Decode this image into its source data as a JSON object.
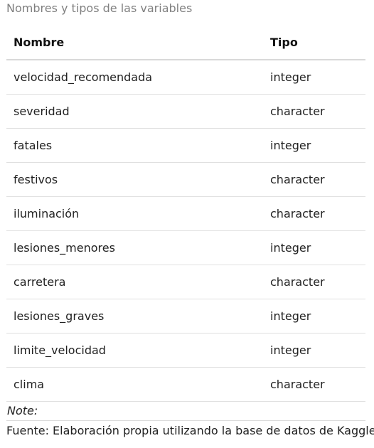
{
  "caption": "Nombres y tipos de las variables",
  "table": {
    "headers": [
      "Nombre",
      "Tipo"
    ],
    "rows": [
      {
        "nombre": "velocidad_recomendada",
        "tipo": "integer"
      },
      {
        "nombre": "severidad",
        "tipo": "character"
      },
      {
        "nombre": "fatales",
        "tipo": "integer"
      },
      {
        "nombre": "festivos",
        "tipo": "character"
      },
      {
        "nombre": "iluminación",
        "tipo": "character"
      },
      {
        "nombre": "lesiones_menores",
        "tipo": "integer"
      },
      {
        "nombre": "carretera",
        "tipo": "character"
      },
      {
        "nombre": "lesiones_graves",
        "tipo": "integer"
      },
      {
        "nombre": "limite_velocidad",
        "tipo": "integer"
      },
      {
        "nombre": "clima",
        "tipo": "character"
      }
    ]
  },
  "note_label": "Note:",
  "source": "Fuente: Elaboración propia utilizando la base de datos de Kaggle"
}
